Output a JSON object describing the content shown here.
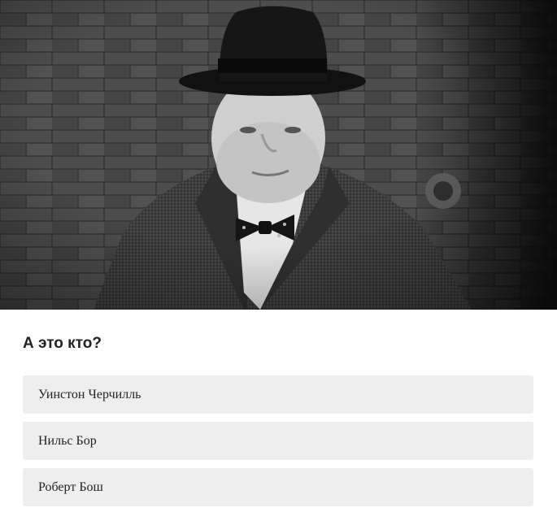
{
  "quiz": {
    "question": "А это кто?",
    "answers": [
      {
        "label": "Уинстон Черчилль"
      },
      {
        "label": "Нильс Бор"
      },
      {
        "label": "Роберт Бош"
      }
    ]
  },
  "colors": {
    "answer_background": "#eeeeee",
    "text": "#222222",
    "page_background": "#ffffff"
  }
}
